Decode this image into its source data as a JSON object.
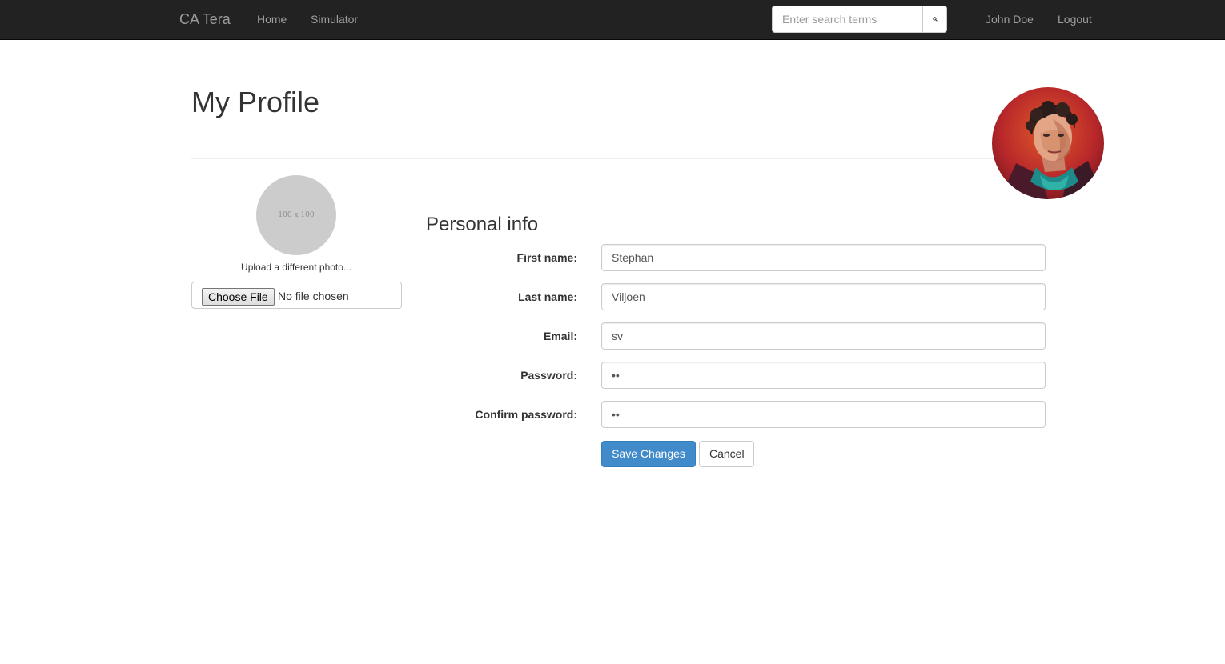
{
  "navbar": {
    "brand": "CA Tera",
    "links": [
      {
        "label": "Home"
      },
      {
        "label": "Simulator"
      }
    ],
    "search": {
      "placeholder": "Enter search terms",
      "value": ""
    },
    "user": "John Doe",
    "logout": "Logout"
  },
  "header": {
    "title": "My Profile"
  },
  "photo": {
    "placeholder_text": "100 x 100",
    "upload_label": "Upload a different photo...",
    "choose_file_label": "Choose File",
    "file_status": "No file chosen"
  },
  "form": {
    "section_title": "Personal info",
    "fields": [
      {
        "label": "First name:",
        "value": "Stephan",
        "type": "text"
      },
      {
        "label": "Last name:",
        "value": "Viljoen",
        "type": "text"
      },
      {
        "label": "Email:",
        "value": "sv",
        "type": "text"
      },
      {
        "label": "Password:",
        "value": "ab",
        "type": "password"
      },
      {
        "label": "Confirm password:",
        "value": "ab",
        "type": "password"
      }
    ],
    "save_label": "Save Changes",
    "cancel_label": "Cancel"
  },
  "colors": {
    "navbar_bg": "#222222",
    "nav_text": "#9d9d9d",
    "primary": "#428bca",
    "placeholder_circle": "#cccccc"
  },
  "icons": {
    "search_button": "search-icon",
    "avatar": "user-avatar-portrait"
  }
}
